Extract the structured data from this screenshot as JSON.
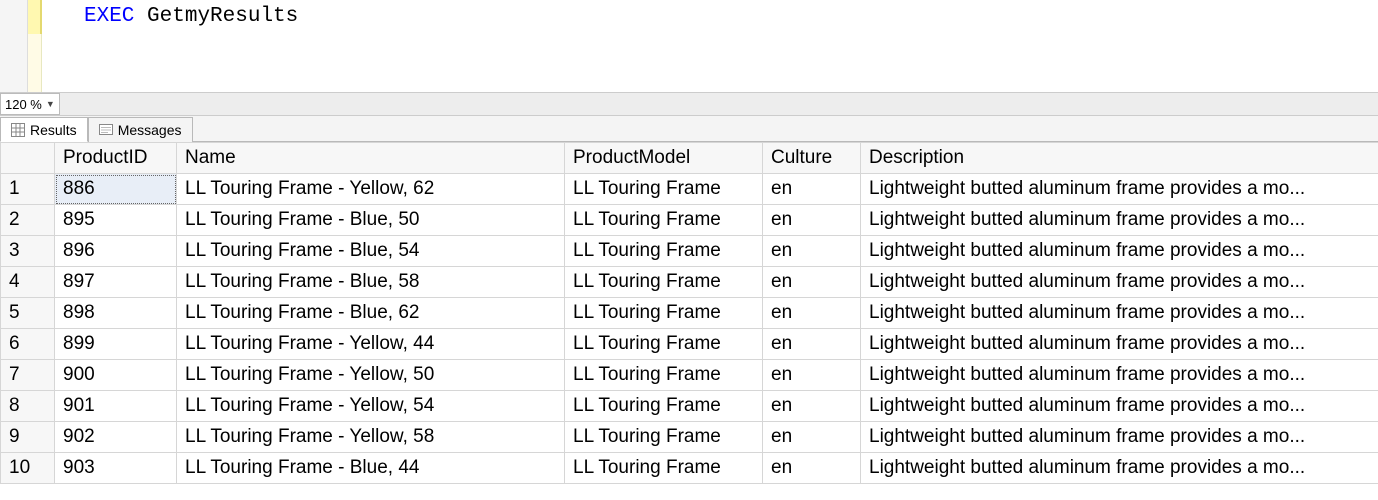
{
  "editor": {
    "exec_keyword": "EXEC",
    "proc_name": "GetmyResults"
  },
  "zoom": {
    "value": "120 %"
  },
  "tabs": {
    "results_label": "Results",
    "messages_label": "Messages"
  },
  "grid": {
    "columns": {
      "product_id": "ProductID",
      "name": "Name",
      "product_model": "ProductModel",
      "culture": "Culture",
      "description": "Description"
    },
    "rows": [
      {
        "n": "1",
        "ProductID": "886",
        "Name": "LL Touring Frame - Yellow, 62",
        "ProductModel": "LL Touring Frame",
        "Culture": "en",
        "Description": "Lightweight butted aluminum frame provides a mo..."
      },
      {
        "n": "2",
        "ProductID": "895",
        "Name": "LL Touring Frame - Blue, 50",
        "ProductModel": "LL Touring Frame",
        "Culture": "en",
        "Description": "Lightweight butted aluminum frame provides a mo..."
      },
      {
        "n": "3",
        "ProductID": "896",
        "Name": "LL Touring Frame - Blue, 54",
        "ProductModel": "LL Touring Frame",
        "Culture": "en",
        "Description": "Lightweight butted aluminum frame provides a mo..."
      },
      {
        "n": "4",
        "ProductID": "897",
        "Name": "LL Touring Frame - Blue, 58",
        "ProductModel": "LL Touring Frame",
        "Culture": "en",
        "Description": "Lightweight butted aluminum frame provides a mo..."
      },
      {
        "n": "5",
        "ProductID": "898",
        "Name": "LL Touring Frame - Blue, 62",
        "ProductModel": "LL Touring Frame",
        "Culture": "en",
        "Description": "Lightweight butted aluminum frame provides a mo..."
      },
      {
        "n": "6",
        "ProductID": "899",
        "Name": "LL Touring Frame - Yellow, 44",
        "ProductModel": "LL Touring Frame",
        "Culture": "en",
        "Description": "Lightweight butted aluminum frame provides a mo..."
      },
      {
        "n": "7",
        "ProductID": "900",
        "Name": "LL Touring Frame - Yellow, 50",
        "ProductModel": "LL Touring Frame",
        "Culture": "en",
        "Description": "Lightweight butted aluminum frame provides a mo..."
      },
      {
        "n": "8",
        "ProductID": "901",
        "Name": "LL Touring Frame - Yellow, 54",
        "ProductModel": "LL Touring Frame",
        "Culture": "en",
        "Description": "Lightweight butted aluminum frame provides a mo..."
      },
      {
        "n": "9",
        "ProductID": "902",
        "Name": "LL Touring Frame - Yellow, 58",
        "ProductModel": "LL Touring Frame",
        "Culture": "en",
        "Description": "Lightweight butted aluminum frame provides a mo..."
      },
      {
        "n": "10",
        "ProductID": "903",
        "Name": "LL Touring Frame - Blue, 44",
        "ProductModel": "LL Touring Frame",
        "Culture": "en",
        "Description": "Lightweight butted aluminum frame provides a mo..."
      }
    ]
  }
}
